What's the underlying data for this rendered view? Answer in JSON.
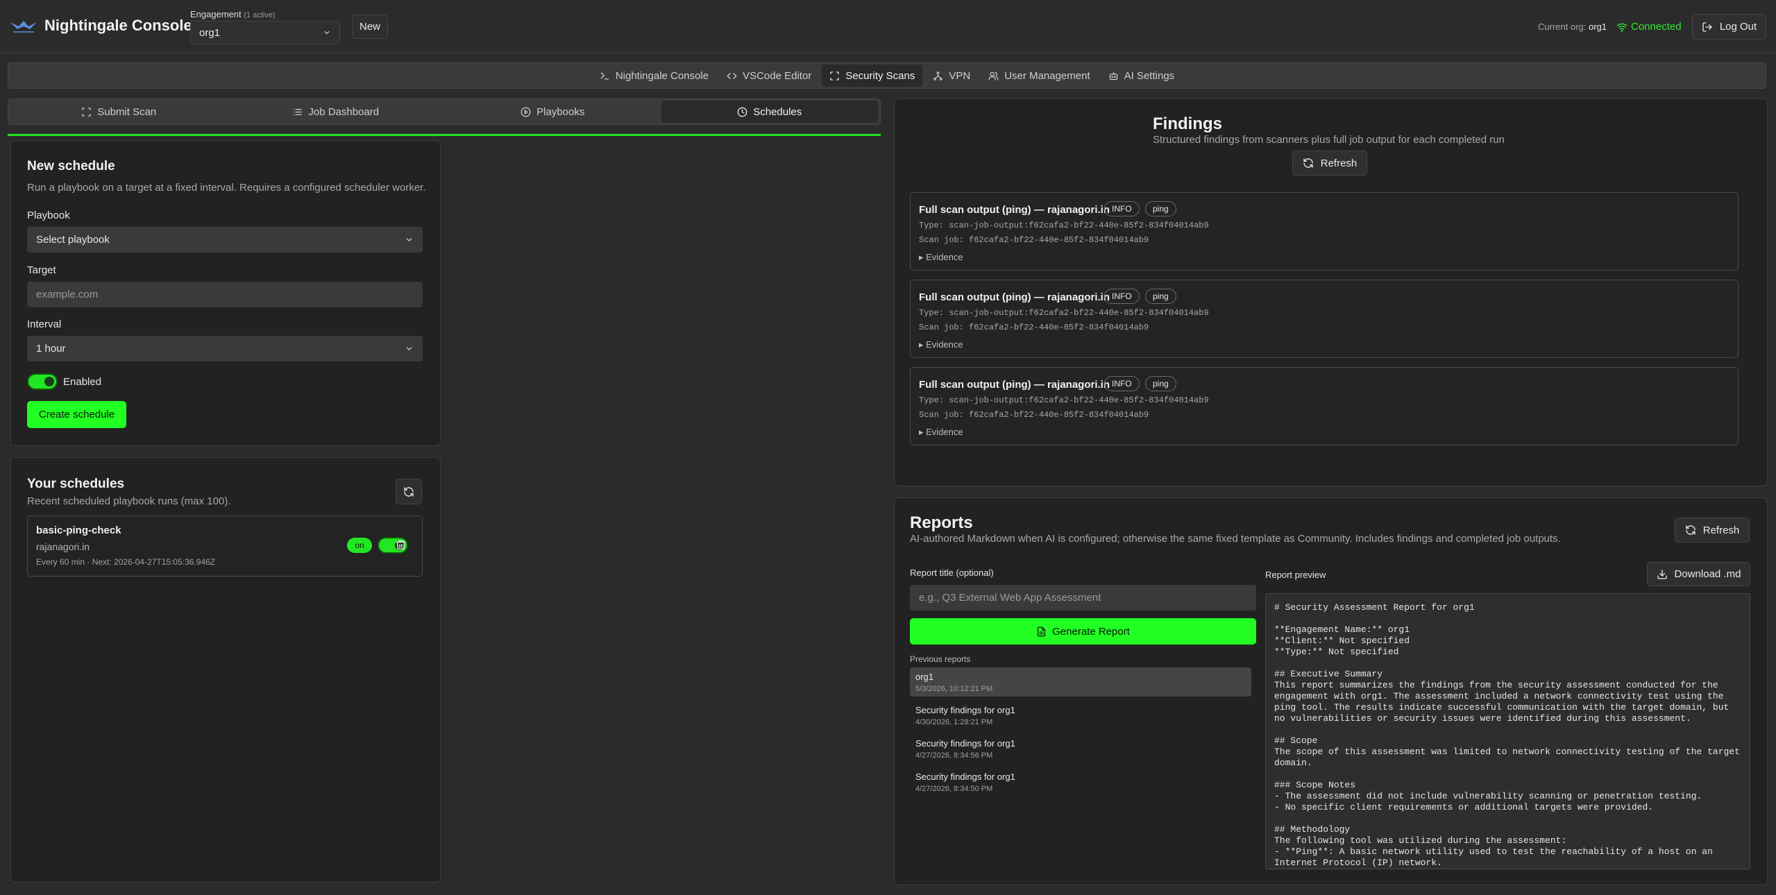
{
  "header": {
    "app_title": "Nightingale Console",
    "engagement_label": "Engagement",
    "engagement_count": "(1 active)",
    "engagement_value": "org1",
    "new_label": "New",
    "current_org_label": "Current org:",
    "current_org_value": "org1",
    "status": "Connected",
    "logout_label": "Log Out"
  },
  "main_nav": [
    {
      "label": "Nightingale Console",
      "icon": "terminal-icon"
    },
    {
      "label": "VSCode Editor",
      "icon": "code-icon"
    },
    {
      "label": "Security Scans",
      "icon": "scan-icon",
      "active": true
    },
    {
      "label": "VPN",
      "icon": "network-icon"
    },
    {
      "label": "User Management",
      "icon": "users-icon"
    },
    {
      "label": "AI Settings",
      "icon": "bot-icon"
    }
  ],
  "sub_nav": [
    {
      "label": "Submit Scan",
      "icon": "scan-icon"
    },
    {
      "label": "Job Dashboard",
      "icon": "list-icon"
    },
    {
      "label": "Playbooks",
      "icon": "play-icon"
    },
    {
      "label": "Schedules",
      "icon": "clock-icon",
      "active": true
    }
  ],
  "new_schedule": {
    "title": "New schedule",
    "subtitle": "Run a playbook on a target at a fixed interval. Requires a configured scheduler worker.",
    "playbook_label": "Playbook",
    "playbook_value": "Select playbook",
    "target_label": "Target",
    "target_placeholder": "example.com",
    "interval_label": "Interval",
    "interval_value": "1 hour",
    "enabled_label": "Enabled",
    "enabled": true,
    "create_label": "Create schedule"
  },
  "your_schedules": {
    "title": "Your schedules",
    "subtitle": "Recent scheduled playbook runs (max 100).",
    "items": [
      {
        "name": "basic-ping-check",
        "target": "rajanagori.in",
        "meta": "Every 60 min · Next: 2026-04-27T15:05:36.946Z",
        "status": "on"
      }
    ]
  },
  "findings": {
    "title": "Findings",
    "subtitle": "Structured findings from scanners plus full job output for each completed run",
    "refresh_label": "Refresh",
    "items": [
      {
        "title": "Full scan output (ping) — rajanagori.in",
        "severity": "INFO",
        "tool": "ping",
        "type": "Type: scan-job-output:f62cafa2-bf22-440e-85f2-834f04014ab9",
        "job": "Scan job: f62cafa2-bf22-440e-85f2-834f04014ab9",
        "evidence": "▸ Evidence"
      },
      {
        "title": "Full scan output (ping) — rajanagori.in",
        "severity": "INFO",
        "tool": "ping",
        "type": "Type: scan-job-output:f62cafa2-bf22-440e-85f2-834f04014ab9",
        "job": "Scan job: f62cafa2-bf22-440e-85f2-834f04014ab9",
        "evidence": "▸ Evidence"
      },
      {
        "title": "Full scan output (ping) — rajanagori.in",
        "severity": "INFO",
        "tool": "ping",
        "type": "Type: scan-job-output:f62cafa2-bf22-440e-85f2-834f04014ab9",
        "job": "Scan job: f62cafa2-bf22-440e-85f2-834f04014ab9",
        "evidence": "▸ Evidence"
      }
    ]
  },
  "reports": {
    "title": "Reports",
    "subtitle": "AI-authored Markdown when AI is configured; otherwise the same fixed template as Community. Includes findings and completed job outputs.",
    "refresh_label": "Refresh",
    "report_title_label": "Report title (optional)",
    "report_title_placeholder": "e.g., Q3 External Web App Assessment",
    "generate_label": "Generate Report",
    "previous_label": "Previous reports",
    "previous": [
      {
        "title": "org1",
        "date": "5/3/2026, 10:12:21 PM",
        "active": true
      },
      {
        "title": "Security findings for org1",
        "date": "4/30/2026, 1:28:21 PM"
      },
      {
        "title": "Security findings for org1",
        "date": "4/27/2026, 8:34:56 PM"
      },
      {
        "title": "Security findings for org1",
        "date": "4/27/2026, 8:34:50 PM"
      }
    ],
    "preview_label": "Report preview",
    "download_label": "Download .md",
    "preview_text": "# Security Assessment Report for org1\n\n**Engagement Name:** org1\n**Client:** Not specified\n**Type:** Not specified\n\n## Executive Summary\nThis report summarizes the findings from the security assessment conducted for the engagement with org1. The assessment included a network connectivity test using the ping tool. The results indicate successful communication with the target domain, but no vulnerabilities or security issues were identified during this assessment.\n\n## Scope\nThe scope of this assessment was limited to network connectivity testing of the target domain.\n\n### Scope Notes\n- The assessment did not include vulnerability scanning or penetration testing.\n- No specific client requirements or additional targets were provided.\n\n## Methodology\nThe following tool was utilized during the assessment:\n- **Ping**: A basic network utility used to test the reachability of a host on an Internet Protocol (IP) network."
  },
  "colors": {
    "accent": "#22ff22",
    "background": "#2b2b2b",
    "panel": "#222222"
  }
}
